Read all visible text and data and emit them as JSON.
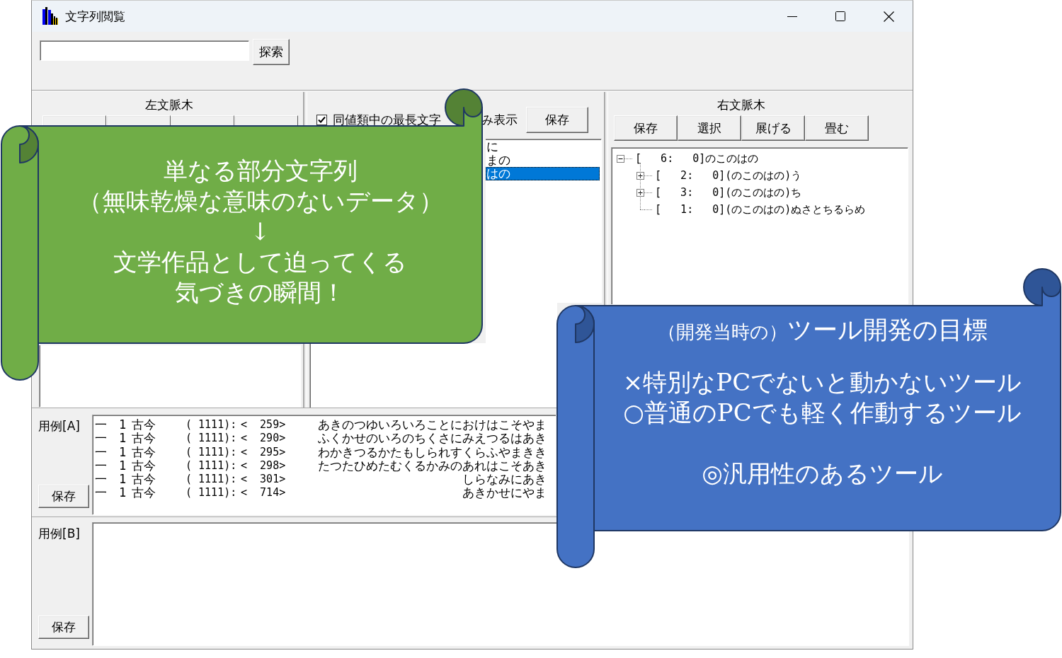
{
  "window": {
    "title": "文字列閲覧"
  },
  "search": {
    "button": "探索"
  },
  "left_panel": {
    "title": "左文脈木"
  },
  "middle_panel": {
    "checkbox": {
      "label": "同値類中の最長文字",
      "checked": true
    },
    "label_fragment": "み表示",
    "button": "保存",
    "list": [
      {
        "text": "に",
        "selected": false
      },
      {
        "text": "まの",
        "selected": false
      },
      {
        "text": "はの",
        "selected": true
      }
    ]
  },
  "right_panel": {
    "title": "右文脈木",
    "buttons": [
      "保存",
      "選択",
      "展げる",
      "畳む"
    ],
    "tree": [
      {
        "label": "[   6:   0]のこのはの",
        "expanded": true,
        "children": [
          {
            "label": "[   2:   0](のこのはの)う",
            "expanded": false
          },
          {
            "label": "[   3:   0](のこのはの)ち",
            "expanded": false
          },
          {
            "label": "[   1:   0](のこのはの)ぬさとちるらめ"
          }
        ]
      }
    ]
  },
  "examples_a": {
    "label": "用例[A]",
    "button": "保存",
    "rows": [
      [
        "一",
        "1",
        "古今",
        "( 1111):",
        "<  259>",
        "あきのつゆいろいろことにおけはこそやま"
      ],
      [
        "一",
        "1",
        "古今",
        "( 1111):",
        "<  290>",
        "ふくかせのいろのちくさにみえつるはあき"
      ],
      [
        "一",
        "1",
        "古今",
        "( 1111):",
        "<  295>",
        "わかきつるかたもしられすくらふやまきき"
      ],
      [
        "一",
        "1",
        "古今",
        "( 1111):",
        "<  298>",
        "たつたひめたむくるかみのあれはこそあき"
      ],
      [
        "一",
        "1",
        "古今",
        "( 1111):",
        "<  301>",
        "しらなみにあき"
      ],
      [
        "一",
        "1",
        "古今",
        "( 1111):",
        "<  714>",
        "あきかせにやま"
      ]
    ]
  },
  "examples_b": {
    "label": "用例[B]",
    "button": "保存"
  },
  "callout_left": {
    "lines": [
      "単なる部分文字列",
      "（無味乾燥な意味のないデータ）",
      "↓",
      "文学作品として迫ってくる",
      "気づきの瞬間！"
    ]
  },
  "callout_right": {
    "note": "（開発当時の）",
    "heading": "ツール開発の目標",
    "lines": [
      "×特別なPCでないと動かないツール",
      "○普通のPCでも軽く作動するツール"
    ],
    "conclusion": "◎汎用性のあるツール"
  }
}
